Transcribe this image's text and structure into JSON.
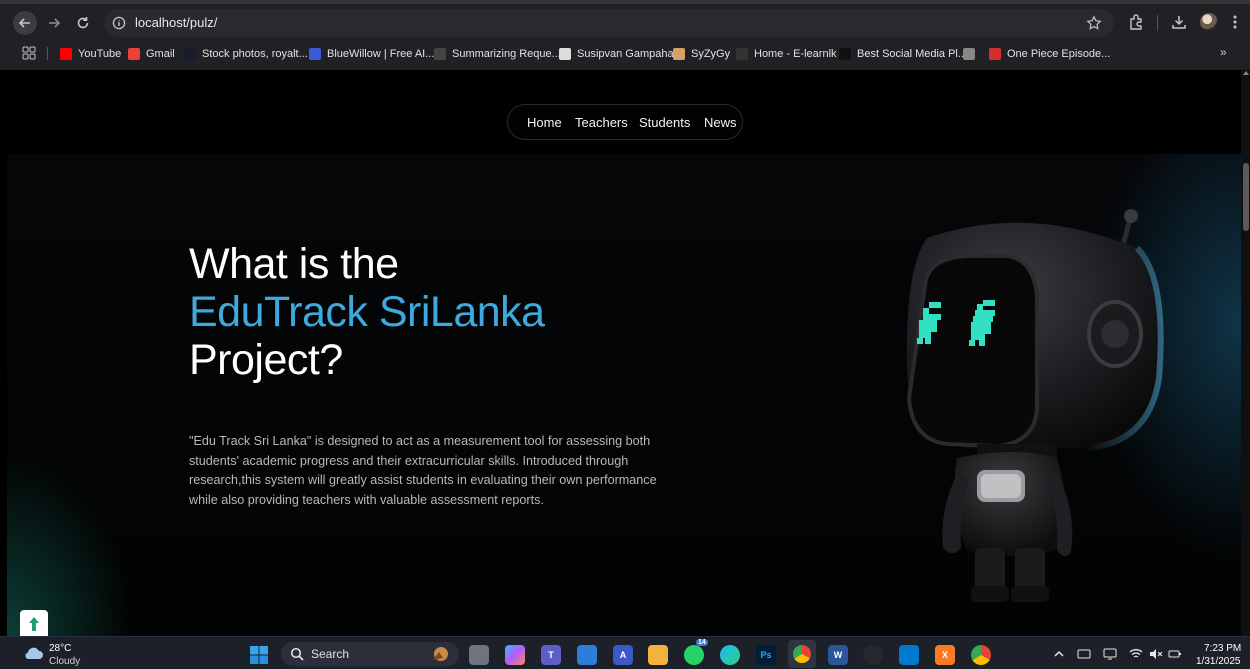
{
  "browser": {
    "url": "localhost/pulz/",
    "bookmarks": [
      {
        "label": "YouTube",
        "icon": "youtube-icon",
        "color": "#ff0000"
      },
      {
        "label": "Gmail",
        "icon": "gmail-icon",
        "color": "#ea4335"
      },
      {
        "label": "Stock photos, royalt...",
        "icon": "stock-icon",
        "color": "#1b1b2f"
      },
      {
        "label": "BlueWillow | Free AI...",
        "icon": "bluewillow-icon",
        "color": "#3b5bdb"
      },
      {
        "label": "Summarizing Reque...",
        "icon": "openai-icon",
        "color": "#444444"
      },
      {
        "label": "Susipvan Gampaha",
        "icon": "susipvan-icon",
        "color": "#dddddd"
      },
      {
        "label": "SyZyGy",
        "icon": "syzygy-icon",
        "color": "#d9a066"
      },
      {
        "label": "Home - E-learnlk",
        "icon": "elearn-icon",
        "color": "#333333"
      },
      {
        "label": "Best Social Media Pl...",
        "icon": "b-icon",
        "color": "#111111"
      },
      {
        "label": "",
        "icon": "globe-icon",
        "color": "#888888"
      },
      {
        "label": "One Piece Episode...",
        "icon": "anime-icon",
        "color": "#d32f2f"
      }
    ]
  },
  "nav": {
    "home": "Home",
    "teachers": "Teachers",
    "students": "Students",
    "news": "News"
  },
  "hero": {
    "line1": "What is the",
    "line2": "EduTrack SriLanka",
    "line3": "Project?",
    "accent_color": "#3fa9dd",
    "description": "\"Edu Track Sri Lanka\" is designed to act as a measurement tool for assessing both students' academic progress and their extracurricular skills. Introduced through research,this system will greatly assist students in evaluating their own performance while also providing teachers with valuable assessment reports."
  },
  "taskbar": {
    "weather_temp": "28°C",
    "weather_desc": "Cloudy",
    "search_label": "Search",
    "whatsapp_badge": "14",
    "time": "7:23 PM",
    "date": "1/31/2025"
  }
}
